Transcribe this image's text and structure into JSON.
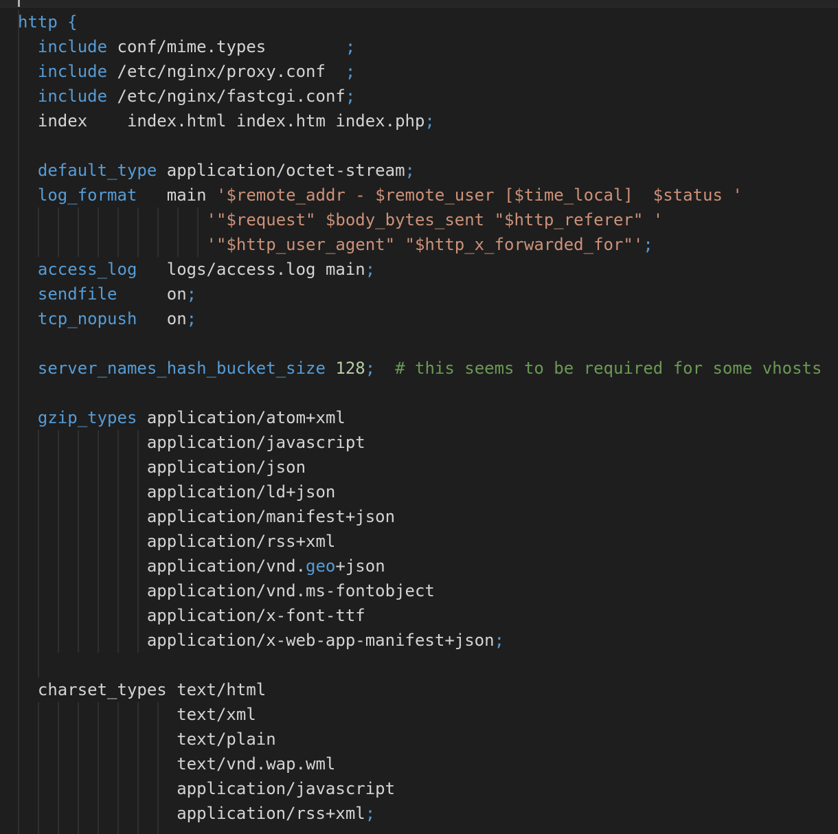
{
  "editor": {
    "theme_colors": {
      "background": "#1e1e1e",
      "keyword": "#569cd6",
      "string": "#ce9178",
      "number": "#b5cea8",
      "comment": "#6a9955",
      "plain": "#d4d4d4",
      "indent_guide": "#404040"
    },
    "lines": [
      [
        {
          "t": "kw",
          "v": "http"
        },
        {
          "t": "kw",
          "v": " {"
        }
      ],
      [
        {
          "t": "pl",
          "v": "  "
        },
        {
          "t": "kw",
          "v": "include"
        },
        {
          "t": "pl",
          "v": " conf/mime.types        "
        },
        {
          "t": "kw",
          "v": ";"
        }
      ],
      [
        {
          "t": "pl",
          "v": "  "
        },
        {
          "t": "kw",
          "v": "include"
        },
        {
          "t": "pl",
          "v": " /etc/nginx/proxy.conf  "
        },
        {
          "t": "kw",
          "v": ";"
        }
      ],
      [
        {
          "t": "pl",
          "v": "  "
        },
        {
          "t": "kw",
          "v": "include"
        },
        {
          "t": "pl",
          "v": " /etc/nginx/fastcgi.conf"
        },
        {
          "t": "kw",
          "v": ";"
        }
      ],
      [
        {
          "t": "pl",
          "v": "  index    index.html index.htm index.php"
        },
        {
          "t": "kw",
          "v": ";"
        }
      ],
      [],
      [
        {
          "t": "pl",
          "v": "  "
        },
        {
          "t": "kw",
          "v": "default_type"
        },
        {
          "t": "pl",
          "v": " application/octet-stream"
        },
        {
          "t": "kw",
          "v": ";"
        }
      ],
      [
        {
          "t": "pl",
          "v": "  "
        },
        {
          "t": "kw",
          "v": "log_format"
        },
        {
          "t": "pl",
          "v": "   main "
        },
        {
          "t": "str",
          "v": "'$remote_addr - $remote_user [$time_local]  $status '"
        }
      ],
      [
        {
          "t": "pl",
          "v": "                   "
        },
        {
          "t": "str",
          "v": "'\"$request\" $body_bytes_sent \"$http_referer\" '"
        }
      ],
      [
        {
          "t": "pl",
          "v": "                   "
        },
        {
          "t": "str",
          "v": "'\"$http_user_agent\" \"$http_x_forwarded_for\"'"
        },
        {
          "t": "kw",
          "v": ";"
        }
      ],
      [
        {
          "t": "pl",
          "v": "  "
        },
        {
          "t": "kw",
          "v": "access_log"
        },
        {
          "t": "pl",
          "v": "   logs/access.log main"
        },
        {
          "t": "kw",
          "v": ";"
        }
      ],
      [
        {
          "t": "pl",
          "v": "  "
        },
        {
          "t": "kw",
          "v": "sendfile"
        },
        {
          "t": "pl",
          "v": "     on"
        },
        {
          "t": "kw",
          "v": ";"
        }
      ],
      [
        {
          "t": "pl",
          "v": "  "
        },
        {
          "t": "kw",
          "v": "tcp_nopush"
        },
        {
          "t": "pl",
          "v": "   on"
        },
        {
          "t": "kw",
          "v": ";"
        }
      ],
      [],
      [
        {
          "t": "pl",
          "v": "  "
        },
        {
          "t": "kw",
          "v": "server_names_hash_bucket_size"
        },
        {
          "t": "pl",
          "v": " "
        },
        {
          "t": "num",
          "v": "128"
        },
        {
          "t": "kw",
          "v": ";"
        },
        {
          "t": "pl",
          "v": "  "
        },
        {
          "t": "cm",
          "v": "# this seems to be required for some vhosts"
        }
      ],
      [],
      [
        {
          "t": "pl",
          "v": "  "
        },
        {
          "t": "kw",
          "v": "gzip_types"
        },
        {
          "t": "pl",
          "v": " application/atom+xml"
        }
      ],
      [
        {
          "t": "pl",
          "v": "             application/javascript"
        }
      ],
      [
        {
          "t": "pl",
          "v": "             application/json"
        }
      ],
      [
        {
          "t": "pl",
          "v": "             application/ld+json"
        }
      ],
      [
        {
          "t": "pl",
          "v": "             application/manifest+json"
        }
      ],
      [
        {
          "t": "pl",
          "v": "             application/rss+xml"
        }
      ],
      [
        {
          "t": "pl",
          "v": "             application/vnd."
        },
        {
          "t": "kw",
          "v": "geo"
        },
        {
          "t": "pl",
          "v": "+json"
        }
      ],
      [
        {
          "t": "pl",
          "v": "             application/vnd.ms-fontobject"
        }
      ],
      [
        {
          "t": "pl",
          "v": "             application/x-font-ttf"
        }
      ],
      [
        {
          "t": "pl",
          "v": "             application/x-web-app-manifest+json"
        },
        {
          "t": "kw",
          "v": ";"
        }
      ],
      [],
      [
        {
          "t": "pl",
          "v": "  charset_types text/html"
        }
      ],
      [
        {
          "t": "pl",
          "v": "                text/xml"
        }
      ],
      [
        {
          "t": "pl",
          "v": "                text/plain"
        }
      ],
      [
        {
          "t": "pl",
          "v": "                text/vnd.wap.wml"
        }
      ],
      [
        {
          "t": "pl",
          "v": "                application/javascript"
        }
      ],
      [
        {
          "t": "pl",
          "v": "                application/rss+xml"
        },
        {
          "t": "kw",
          "v": ";"
        }
      ]
    ]
  }
}
